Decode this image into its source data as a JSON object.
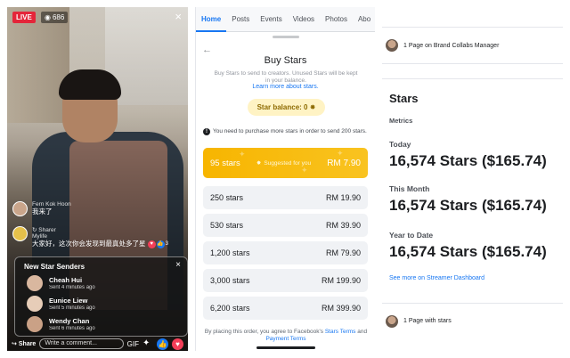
{
  "live": {
    "live_label": "LIVE",
    "viewer_count": "686",
    "comments": [
      {
        "name": "Fern Kok Hoon",
        "text": "我来了"
      },
      {
        "name": "Mylife",
        "badge": "Sharer",
        "text": "大家好，这次你会发现到最真处多了星"
      }
    ],
    "senders_title": "New Star Senders",
    "senders": [
      {
        "name": "Cheah Hui",
        "time": "Sent 4 minutes ago"
      },
      {
        "name": "Eunice Liew",
        "time": "Sent 5 minutes ago"
      },
      {
        "name": "Wendy Chan",
        "time": "Sent 6 minutes ago"
      }
    ],
    "share_label": "Share",
    "comment_placeholder": "Write a comment...",
    "gif_label": "GIF",
    "reaction_count": "3"
  },
  "buy": {
    "tabs": [
      "Home",
      "Posts",
      "Events",
      "Videos",
      "Photos",
      "Abo"
    ],
    "active_tab": "Home",
    "title": "Buy Stars",
    "subtitle": "Buy Stars to send to creators. Unused Stars will be kept in your balance.",
    "learn_more": "Learn more about stars.",
    "balance": "Star balance: 0",
    "notice": "You need to purchase more stars in order to send 200 stars.",
    "featured": {
      "stars": "95 stars",
      "suggested": "Suggested for you",
      "price": "RM 7.90"
    },
    "packages": [
      {
        "stars": "250 stars",
        "price": "RM 19.90"
      },
      {
        "stars": "530 stars",
        "price": "RM 39.90"
      },
      {
        "stars": "1,200 stars",
        "price": "RM 79.90"
      },
      {
        "stars": "3,000 stars",
        "price": "RM 199.90"
      },
      {
        "stars": "6,200 stars",
        "price": "RM 399.90"
      }
    ],
    "terms_prefix": "By placing this order, you agree to Facebook's",
    "terms_link1": "Stars Terms",
    "terms_and": "and",
    "terms_link2": "Payment Terms"
  },
  "stats": {
    "brand_row": "1 Page on Brand Collabs Manager",
    "title": "Stars",
    "metrics_label": "Metrics",
    "periods": [
      {
        "label": "Today",
        "value": "16,574 Stars ($165.74)"
      },
      {
        "label": "This Month",
        "value": "16,574 Stars ($165.74)"
      },
      {
        "label": "Year to Date",
        "value": "16,574 Stars ($165.74)"
      }
    ],
    "see_more": "See more on Streamer Dashboard",
    "with_stars_row": "1 Page with stars"
  },
  "colors": {
    "facebook_blue": "#1877f2",
    "live_red": "#e4253a",
    "star_gold": "#f7b500"
  }
}
